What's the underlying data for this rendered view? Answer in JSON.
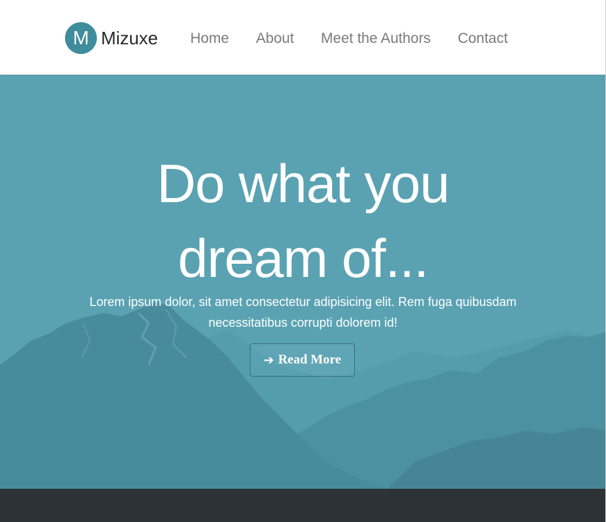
{
  "brand": {
    "logo_letter": "M",
    "name": "Mizuxe",
    "color": "#3f8c9c"
  },
  "nav": {
    "items": [
      {
        "label": "Home"
      },
      {
        "label": "About"
      },
      {
        "label": "Meet the Authors"
      },
      {
        "label": "Contact"
      }
    ]
  },
  "hero": {
    "title_line1": "Do what you",
    "title_line2": "dream of...",
    "text": "Lorem ipsum dolor, sit amet consectetur adipisicing elit. Rem fuga quibusdam necessitatibus corrupti dolorem id!",
    "button_label": "Read More",
    "button_icon": "arrow-right-icon",
    "background_color": "#5aa2b2"
  },
  "footer": {
    "color": "#2d3236"
  }
}
